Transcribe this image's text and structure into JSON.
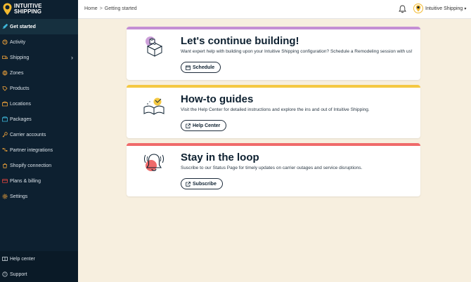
{
  "brand": {
    "line1": "INTUITIVE",
    "line2": "SHIPPING"
  },
  "sidebar": {
    "items": [
      {
        "label": "Get started",
        "icon": "rocket-icon",
        "active": true
      },
      {
        "label": "Activity",
        "icon": "activity-icon"
      },
      {
        "label": "Shipping",
        "icon": "shipping-icon",
        "chevron": "›"
      },
      {
        "label": "Zones",
        "icon": "zones-icon"
      },
      {
        "label": "Products",
        "icon": "products-icon"
      },
      {
        "label": "Locations",
        "icon": "locations-icon"
      },
      {
        "label": "Packages",
        "icon": "packages-icon"
      },
      {
        "label": "Carrier accounts",
        "icon": "key-icon"
      },
      {
        "label": "Partner integrations",
        "icon": "integrations-icon"
      },
      {
        "label": "Shopify connection",
        "icon": "shopify-icon"
      },
      {
        "label": "Plans & billing",
        "icon": "billing-icon"
      },
      {
        "label": "Settings",
        "icon": "gear-icon"
      }
    ],
    "bottom": [
      {
        "label": "Help center",
        "icon": "book-icon"
      },
      {
        "label": "Support",
        "icon": "help-circle-icon"
      }
    ]
  },
  "header": {
    "breadcrumb": [
      "Home",
      "Getting started"
    ],
    "breadcrumb_sep": ">",
    "account_name": "Intuitive Shipping",
    "account_caret": "▾"
  },
  "cards": [
    {
      "title": "Let's continue building!",
      "description": "Want expert help with building upon your Intuitive Shipping configuration? Schedule a Remodeling session with us!",
      "button": "Schedule",
      "accent": "#c48fd4"
    },
    {
      "title": "How-to guides",
      "description": "Visit the Help Center for detailed instructions and explore the ins and out of Intuitive Shipping.",
      "button": "Help Center",
      "accent": "#f4c842"
    },
    {
      "title": "Stay in the loop",
      "description": "Suscribe to our Status Page for timely updates on carrier outages and service disruptions.",
      "button": "Subscribe",
      "accent": "#ef6a6a"
    }
  ],
  "colors": {
    "sidebar_bg": "#0d2030",
    "page_bg": "#f7efdf",
    "brand_yellow": "#f2b92f"
  }
}
